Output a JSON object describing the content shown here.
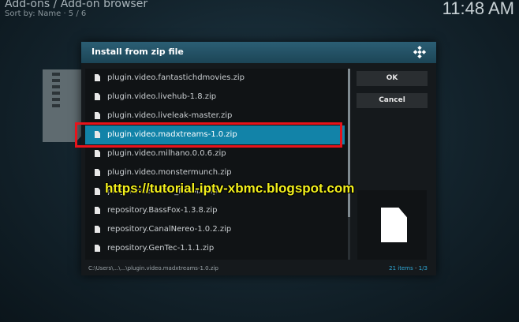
{
  "header": {
    "title": "Add-ons / Add-on browser",
    "sort": "Sort by: Name  ·  5 / 6",
    "clock": "11:48 AM"
  },
  "dialog": {
    "title": "Install from zip file",
    "items": [
      "plugin.video.fantastichdmovies.zip",
      "plugin.video.livehub-1.8.zip",
      "plugin.video.liveleak-master.zip",
      "plugin.video.madxtreams-1.0.zip",
      "plugin.video.milhano.0.0.6.zip",
      "plugin.video.monstermunch.zip",
      "plugin.video.OTV_MEDIA.zip",
      "repository.BassFox-1.3.8.zip",
      "repository.CanalNereo-1.0.2.zip",
      "repository.GenTec-1.1.1.zip"
    ],
    "focused_index": 3,
    "ok_label": "OK",
    "cancel_label": "Cancel",
    "path": "C:\\Users\\...\\...\\plugin.video.madxtreams-1.0.zip",
    "item_count": "21 items",
    "page": "1/3",
    "accent_color": "#1283a8"
  },
  "overlay": {
    "watermark": "https://tutorial-iptv-xbmc.blogspot.com",
    "highlight_color": "#e8131b"
  }
}
